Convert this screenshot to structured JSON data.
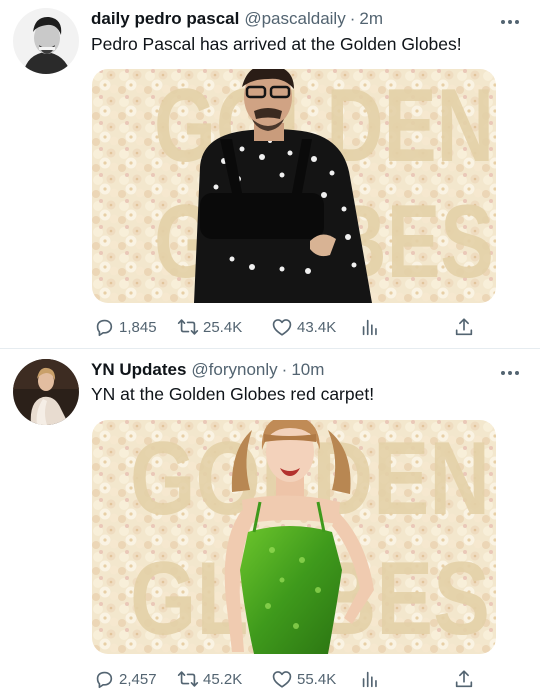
{
  "tweets": [
    {
      "name": "daily pedro pascal",
      "handle": "@pascaldaily",
      "separator": "·",
      "time": "2m",
      "text": "Pedro Pascal has arrived at the Golden Globes!",
      "backdrop_word_top": "GOLDEN",
      "backdrop_word_bottom": "GLOBES",
      "replies": "1,845",
      "retweets": "25.4K",
      "likes": "43.4K"
    },
    {
      "name": "YN Updates",
      "handle": "@forynonly",
      "separator": "·",
      "time": "10m",
      "text": "YN at the Golden Globes red carpet!",
      "backdrop_word_top": "GOLDEN",
      "backdrop_word_bottom": "GLOBES",
      "replies": "2,457",
      "retweets": "45.2K",
      "likes": "55.4K"
    }
  ],
  "colors": {
    "text_primary": "#0f1419",
    "text_secondary": "#536471",
    "divider": "#e6ecf0",
    "flower_backdrop": "#f3e7cd",
    "letter_color": "#e4d1a8",
    "dress_green": "#3f9a1c"
  },
  "icons": [
    "more-icon",
    "reply-icon",
    "retweet-icon",
    "like-icon",
    "views-icon",
    "share-icon"
  ]
}
